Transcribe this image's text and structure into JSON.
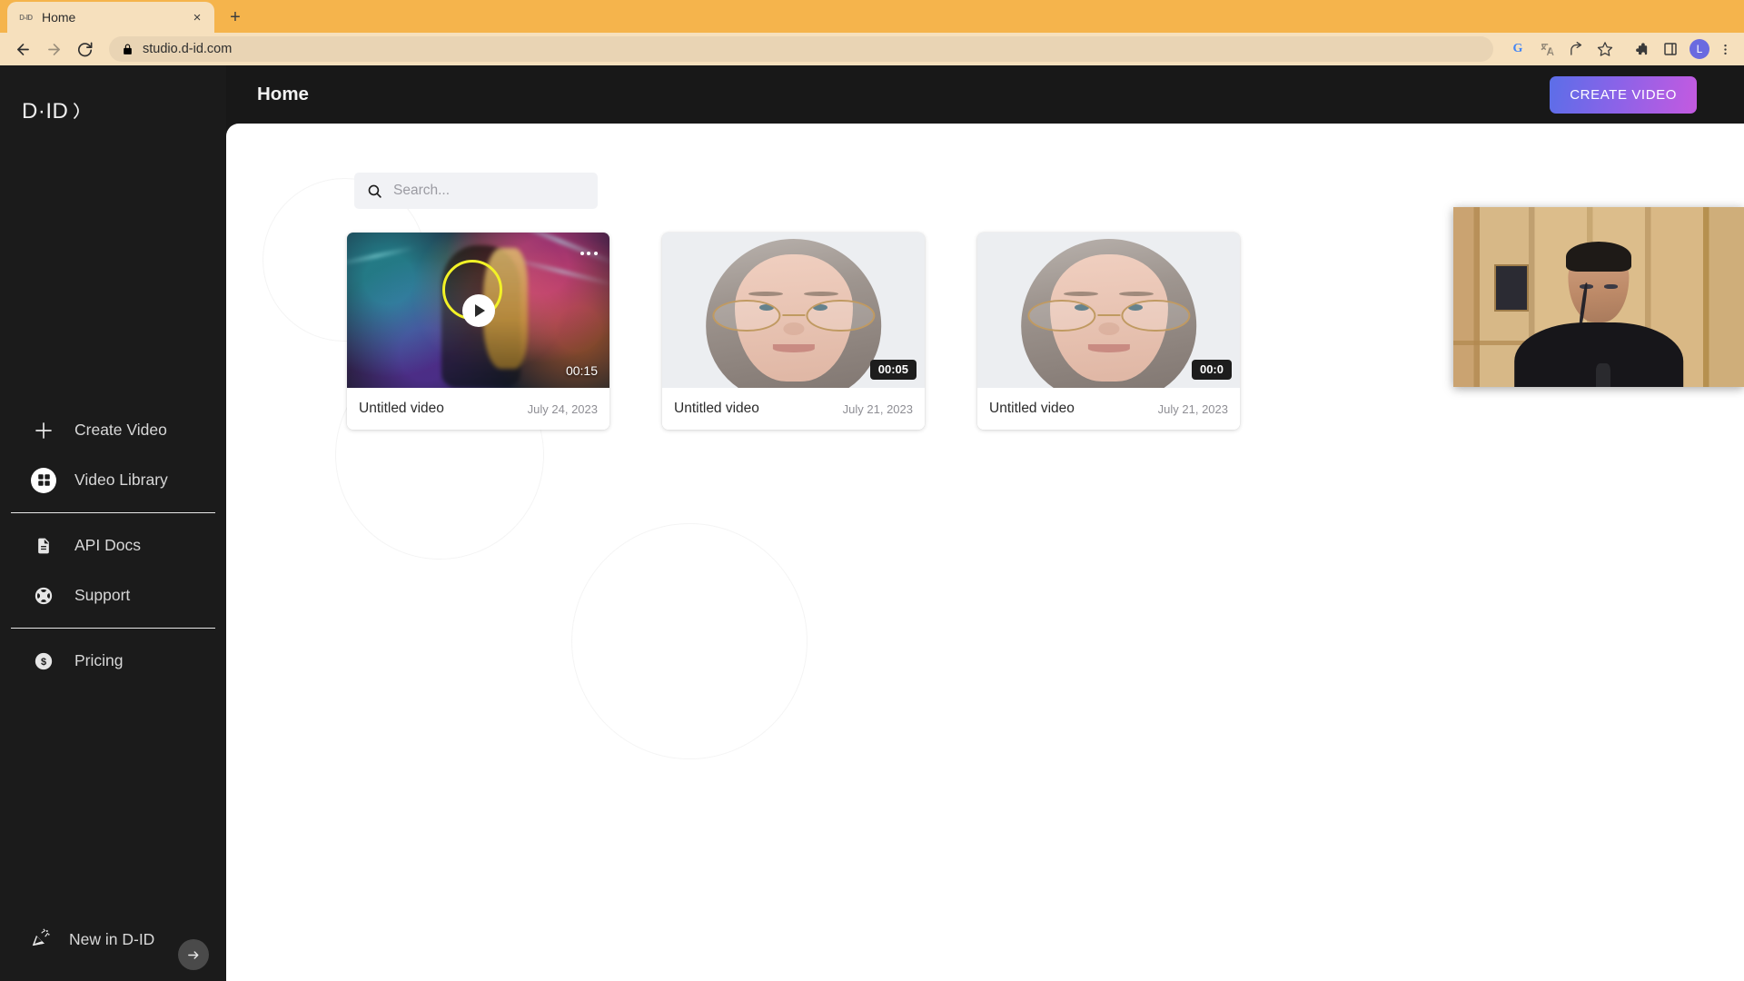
{
  "browser": {
    "tab": {
      "title": "Home",
      "favicon": "D-ID",
      "close_label": "×"
    },
    "new_tab_label": "+",
    "url": "studio.d-id.com",
    "nav": {
      "back": "←",
      "forward": "→",
      "reload": "↻"
    },
    "toolbar_icons": [
      "google-icon",
      "translate-icon",
      "share-icon",
      "bookmark-star-icon",
      "extensions-icon",
      "side-panel-icon",
      "profile-avatar",
      "chrome-menu-icon"
    ],
    "profile_initial": "L",
    "menu_label": "⋮"
  },
  "sidebar": {
    "logo_text": "D-ID",
    "primary_items": [
      {
        "label": "Create Video",
        "icon": "plus-icon",
        "active": false
      },
      {
        "label": "Video Library",
        "icon": "grid-icon",
        "active": true
      }
    ],
    "secondary_items": [
      {
        "label": "API Docs",
        "icon": "document-icon"
      },
      {
        "label": "Support",
        "icon": "lifebuoy-icon"
      }
    ],
    "tertiary_items": [
      {
        "label": "Pricing",
        "icon": "dollar-circle-icon"
      }
    ],
    "bottom_item": {
      "label": "New in D-ID",
      "icon": "party-popper-icon"
    },
    "collapse_button": "collapse-sidebar-icon"
  },
  "header": {
    "title": "Home",
    "create_video_label": "CREATE VIDEO",
    "create_video_gradient_from": "#5b6ee8",
    "create_video_gradient_to": "#c45ae0"
  },
  "search": {
    "placeholder": "Search...",
    "value": "",
    "icon": "search-icon"
  },
  "videos": [
    {
      "title": "Untitled video",
      "date": "July 24, 2023",
      "duration": "00:15",
      "thumbnail": "neon-cyberpunk-portrait",
      "has_play_button": true,
      "has_kebab_menu": true,
      "hovered": true
    },
    {
      "title": "Untitled video",
      "date": "July 21, 2023",
      "duration": "00:05",
      "thumbnail": "elderly-woman-glasses-portrait",
      "has_play_button": false,
      "has_kebab_menu": false,
      "hovered": false
    },
    {
      "title": "Untitled video",
      "date": "July 21, 2023",
      "duration": "00:0",
      "thumbnail": "elderly-woman-glasses-portrait",
      "has_play_button": false,
      "has_kebab_menu": false,
      "hovered": false
    }
  ],
  "webcam_overlay": {
    "description": "presenter-webcam-feed",
    "visible": true
  },
  "colors": {
    "browser_tabstrip": "#f5b44c",
    "browser_toolbar": "#f6e0bd",
    "sidebar_bg": "#1b1b1b",
    "app_bg": "#181818",
    "content_bg": "#ffffff",
    "accent": "#8a63e8"
  }
}
